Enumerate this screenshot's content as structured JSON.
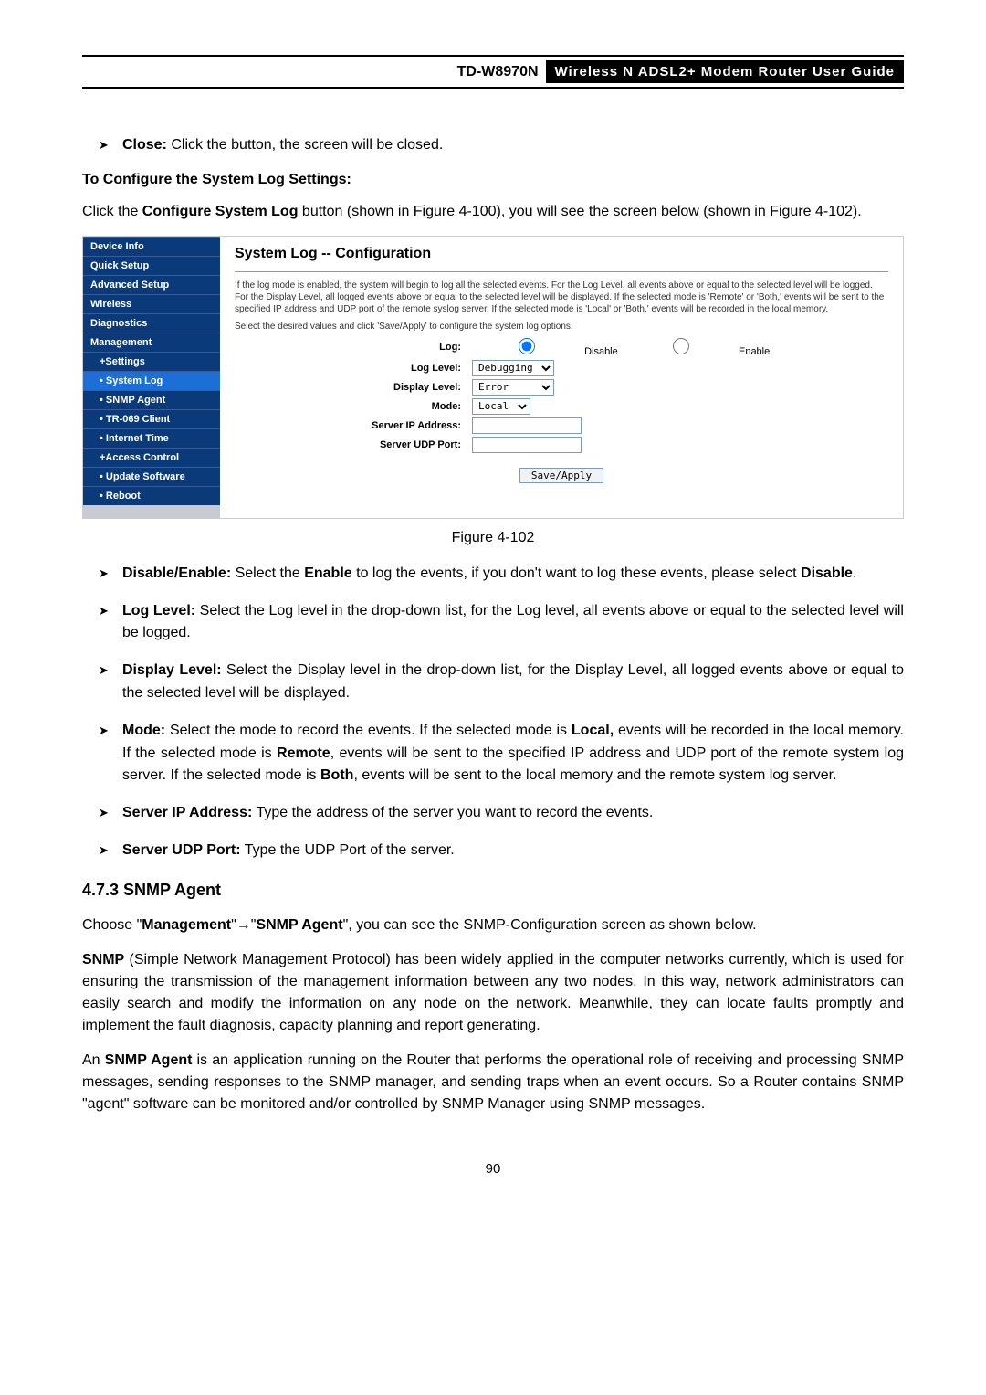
{
  "header": {
    "model": "TD-W8970N",
    "guide": "Wireless  N  ADSL2+  Modem  Router  User  Guide"
  },
  "close_line": {
    "label": "Close:",
    "text": " Click the button, the screen will be closed."
  },
  "config_title": "To Configure the System Log Settings:",
  "config_para_a": "Click the ",
  "config_para_b": "Configure System Log",
  "config_para_c": " button (shown in Figure 4-100), you will see the screen below (shown in Figure 4-102).",
  "sidebar": {
    "items": [
      "Device Info",
      "Quick Setup",
      "Advanced Setup",
      "Wireless",
      "Diagnostics",
      "Management"
    ],
    "sub": [
      "+Settings",
      "• System Log",
      "• SNMP Agent",
      "• TR-069 Client",
      "• Internet Time",
      "+Access Control",
      "• Update Software",
      "• Reboot"
    ]
  },
  "ssmain": {
    "heading": "System Log -- Configuration",
    "desc1": "If the log mode is enabled, the system will begin to log all the selected events. For the Log Level, all events above or equal to the selected level will be logged. For the Display Level, all logged events above or equal to the selected level will be displayed. If the selected mode is 'Remote' or 'Both,' events will be sent to the specified IP address and UDP port of the remote syslog server. If the selected mode is 'Local' or 'Both,' events will be recorded in the local memory.",
    "desc2": "Select the desired values and click 'Save/Apply' to configure the system log options.",
    "labels": {
      "log": "Log:",
      "loglevel": "Log Level:",
      "displaylevel": "Display Level:",
      "mode": "Mode:",
      "serverip": "Server IP Address:",
      "serverudp": "Server UDP Port:"
    },
    "radio_disable": "Disable",
    "radio_enable": "Enable",
    "loglevel_val": "Debugging",
    "displaylevel_val": "Error",
    "mode_val": "Local",
    "save_btn": "Save/Apply"
  },
  "fig_caption": "Figure 4-102",
  "bullets": {
    "b1": {
      "a": "Disable/Enable:",
      "b": " Select the ",
      "c": "Enable",
      "d": " to log the events, if you don't want to log these events, please select ",
      "e": "Disable",
      "f": "."
    },
    "b2": {
      "a": "Log Level:",
      "b": " Select the Log level in the drop-down list, for the Log level, all events above or equal to the selected level will be logged."
    },
    "b3": {
      "a": "Display Level:",
      "b": " Select the Display level in the drop-down list, for the Display Level, all logged events above or equal to the selected level will be displayed."
    },
    "b4": {
      "a": "Mode:",
      "b": " Select the mode to record the events. If the selected mode is ",
      "c": "Local,",
      "d": " events will be recorded in the local memory. If the selected mode is ",
      "e": "Remote",
      "f": ", events will be sent to the specified IP address and UDP port of the remote system log server. If the selected mode is ",
      "g": "Both",
      "h": ", events will be sent to the local memory and the remote system log server."
    },
    "b5": {
      "a": "Server IP Address:",
      "b": " Type the address of the server you want to record the events."
    },
    "b6": {
      "a": "Server UDP Port:",
      "b": " Type the UDP Port of the server."
    }
  },
  "h473": "4.7.3   SNMP Agent",
  "snmp_para1": {
    "a": "Choose \"",
    "b": "Management",
    "c": "\"→\"",
    "d": "SNMP Agent",
    "e": "\", you can see the SNMP-Configuration screen as shown below."
  },
  "snmp_para2": {
    "a": "SNMP",
    "b": " (Simple Network Management Protocol) has been widely applied in the computer networks currently, which is used for ensuring the transmission of the management information between any two nodes. In this way, network administrators can easily search and modify the information on any node on the network. Meanwhile, they can locate faults promptly and implement the fault diagnosis, capacity planning and report generating."
  },
  "snmp_para3": {
    "a": "An ",
    "b": "SNMP Agent",
    "c": " is an application running on the Router that performs the operational role of receiving and processing SNMP messages, sending responses to the SNMP manager, and sending traps when an event occurs. So a Router contains SNMP \"agent\" software can be monitored and/or controlled by SNMP Manager using SNMP messages."
  },
  "page_num": "90"
}
